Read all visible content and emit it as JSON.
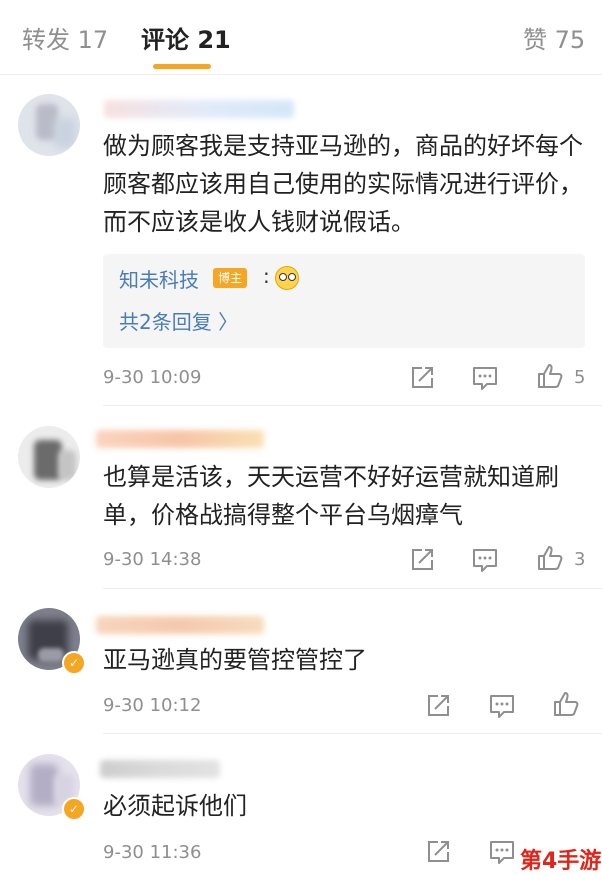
{
  "tabs": [
    {
      "label": "转发 17",
      "active": false
    },
    {
      "label": "评论 21",
      "active": true
    },
    {
      "label": "赞 75",
      "active": false
    }
  ],
  "accent_color": "#f5a623",
  "link_color": "#4a7db8",
  "comments": [
    {
      "text": "做为顾客我是支持亚马逊的，商品的好坏每个顾客都应该用自己使用的实际情况进行评价，而不应该是收人钱财说假话。",
      "time": "9-30 10:09",
      "likes": "5",
      "reply": {
        "author": "知未科技",
        "tag": "博主",
        "colon": ":",
        "emoji": "glasses-face-emoji",
        "count_label": "共2条回复 〉"
      }
    },
    {
      "text": "也算是活该，天天运营不好好运营就知道刷单，价格战搞得整个平台乌烟瘴气",
      "time": "9-30 14:38",
      "likes": "3"
    },
    {
      "text": "亚马逊真的要管控管控了",
      "time": "9-30 10:12",
      "likes": ""
    },
    {
      "text": "必须起诉他们",
      "time": "9-30 11:36",
      "likes": ""
    }
  ],
  "icons": {
    "share": "share-icon",
    "comment": "comment-icon",
    "like": "thumbs-up-icon"
  },
  "watermark": "第4手游"
}
